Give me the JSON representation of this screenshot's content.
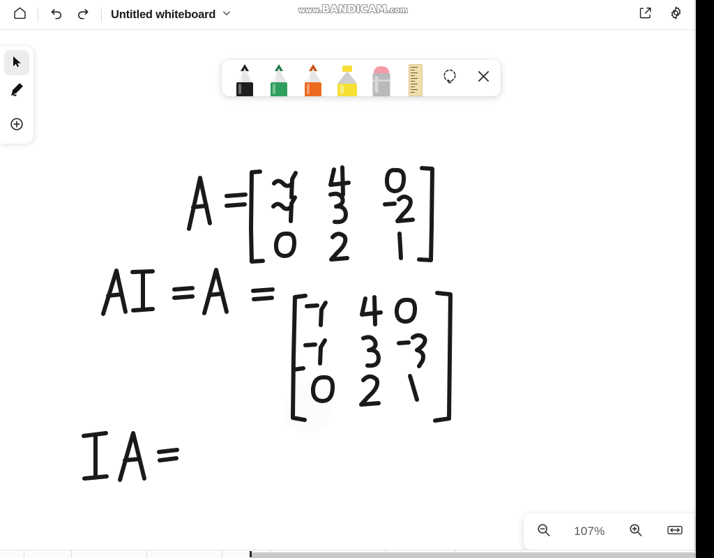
{
  "window": {
    "title": "Untitled whiteboard",
    "watermark_prefix": "www.",
    "watermark_main": "BANDICAM",
    "watermark_suffix": ".com"
  },
  "header": {
    "home_label": "Home",
    "undo_label": "Undo",
    "redo_label": "Redo",
    "title_dropdown_label": "Open document menu",
    "share_label": "Share",
    "settings_label": "Settings",
    "icons": {
      "home": "home-icon",
      "undo": "undo-icon",
      "redo": "redo-icon",
      "chevron": "chevron-down-icon",
      "share": "share-icon",
      "settings": "gear-icon"
    }
  },
  "left_rail": {
    "items": [
      {
        "name": "select-tool",
        "icon": "cursor-arrow-icon",
        "label": "Select",
        "active": true
      },
      {
        "name": "pen-tool",
        "icon": "pen-icon",
        "label": "Draw",
        "active": false
      },
      {
        "name": "add-tool",
        "icon": "plus-circle-icon",
        "label": "Insert",
        "active": false
      }
    ]
  },
  "pen_toolbar": {
    "tools": [
      {
        "name": "pen-black",
        "label": "Black pen",
        "color": "#1e1e1e",
        "type": "pen"
      },
      {
        "name": "pen-green",
        "label": "Green pen",
        "color": "#2f9e5e",
        "type": "pen"
      },
      {
        "name": "pen-orange",
        "label": "Orange pen",
        "color": "#ec6a1e",
        "type": "pen"
      },
      {
        "name": "highlighter-yellow",
        "label": "Yellow highlighter",
        "color": "#f6e033",
        "type": "highlighter"
      },
      {
        "name": "eraser",
        "label": "Eraser",
        "color": "#f49ba8",
        "type": "eraser"
      },
      {
        "name": "ruler",
        "label": "Ruler",
        "color": "#f0dfae",
        "type": "ruler"
      },
      {
        "name": "lasso-select",
        "label": "Lasso select",
        "color": "#2b2b2b",
        "type": "icon"
      },
      {
        "name": "close-toolbar",
        "label": "Close",
        "color": "#2b2b2b",
        "type": "icon"
      }
    ]
  },
  "canvas": {
    "title": "Whiteboard canvas",
    "handwriting": [
      {
        "id": "line-1",
        "text": "A = [ -1 4 0 ; -1 3 -2 ; 0 2 1 ]",
        "label_left": "A",
        "equals": "=",
        "matrix": [
          [
            "-1",
            "4",
            "0"
          ],
          [
            "-1",
            "3",
            "-2"
          ],
          [
            "0",
            "2",
            "1"
          ]
        ]
      },
      {
        "id": "line-2",
        "text": "AI = A = [ -1 4 0 ; -1 3 -2 ; 0 2 1 ]",
        "label_left": "AI",
        "equals": "=",
        "label_mid": "A",
        "equals2": "=",
        "matrix": [
          [
            "-1",
            "4",
            "0"
          ],
          [
            "-1",
            "3",
            "-2"
          ],
          [
            "0",
            "2",
            "1"
          ]
        ]
      },
      {
        "id": "line-3",
        "text": "IA =",
        "label_left": "IA",
        "equals": "=",
        "matrix": []
      }
    ]
  },
  "zoom_control": {
    "zoom_out_label": "Zoom out",
    "zoom_level": "107%",
    "zoom_in_label": "Zoom in",
    "fit_label": "Fit to width"
  },
  "colors": {
    "page_background": "#ffffff",
    "ink": "#1a1a1a",
    "chrome_border": "#e9e9ea",
    "right_bar": "#000000",
    "zoom_text": "#59595c"
  }
}
